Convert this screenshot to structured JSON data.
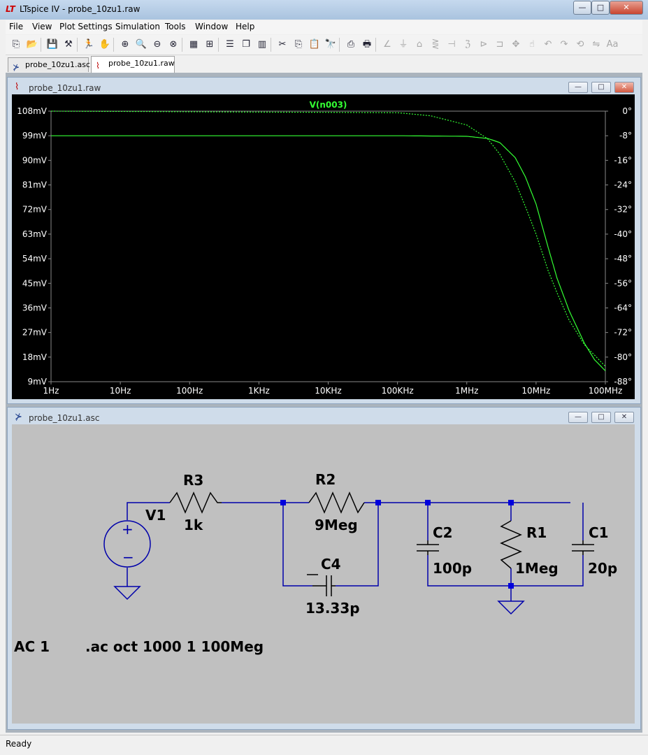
{
  "window": {
    "title": "LTspice IV - probe_10zu1.raw",
    "app_icon": "LT",
    "buttons": {
      "minimize": "—",
      "maximize": "□",
      "close": "✕"
    }
  },
  "menu": [
    "File",
    "View",
    "Plot Settings",
    "Simulation",
    "Tools",
    "Window",
    "Help"
  ],
  "toolbar": {
    "icons": [
      "open-schematic-icon",
      "open-file-icon",
      "save-icon",
      "control-panel-icon",
      "run-icon",
      "halt-icon",
      "zoom-in-icon",
      "zoom-area-icon",
      "zoom-out-icon",
      "zoom-cancel-icon",
      "autorange-icon",
      "mark-icon",
      "tile-horizontal-icon",
      "cascade-icon",
      "tile-vertical-icon",
      "cut-icon",
      "copy-icon",
      "paste-icon",
      "find-icon",
      "print-setup-icon",
      "print-icon",
      "wire-icon",
      "ground-icon",
      "label-icon",
      "resistor-icon",
      "capacitor-icon",
      "inductor-icon",
      "diode-icon",
      "component-icon",
      "move-icon",
      "drag-icon",
      "undo-icon",
      "redo-icon",
      "rotate-icon",
      "mirror-icon",
      "text-icon"
    ]
  },
  "tabs": [
    {
      "label": "probe_10zu1.asc",
      "icon": "schematic-icon",
      "active": false
    },
    {
      "label": "probe_10zu1.raw",
      "icon": "waveform-icon",
      "active": true
    }
  ],
  "plot_window": {
    "title": "probe_10zu1.raw",
    "trace_label": "V(n003)",
    "trace_color": "#33ff33",
    "background": "#000000"
  },
  "chart_data": {
    "type": "line",
    "xscale": "log",
    "xlim": [
      1,
      100000000
    ],
    "x_ticks": [
      "1Hz",
      "10Hz",
      "100Hz",
      "1KHz",
      "10KHz",
      "100KHz",
      "1MHz",
      "10MHz",
      "100MHz"
    ],
    "y_left_ticks": [
      "108mV",
      "99mV",
      "90mV",
      "81mV",
      "72mV",
      "63mV",
      "54mV",
      "45mV",
      "36mV",
      "27mV",
      "18mV",
      "9mV"
    ],
    "y_right_ticks": [
      "0°",
      "-8°",
      "-16°",
      "-24°",
      "-32°",
      "-40°",
      "-48°",
      "-56°",
      "-64°",
      "-72°",
      "-80°",
      "-88°"
    ],
    "ylim_left": [
      9,
      108
    ],
    "ylim_right": [
      -88,
      0
    ],
    "series": [
      {
        "name": "V(n003)",
        "style": "solid",
        "axis": "left",
        "x": [
          1,
          1000,
          100000,
          1000000,
          2000000,
          3000000,
          5000000,
          7000000,
          10000000,
          15000000,
          20000000,
          30000000,
          50000000,
          70000000,
          100000000
        ],
        "y": [
          99,
          99,
          99,
          98.8,
          98,
          96.5,
          91,
          84,
          74,
          58,
          47,
          35,
          23,
          17,
          13
        ]
      },
      {
        "name": "phase",
        "style": "dotted",
        "axis": "right",
        "x": [
          1,
          100000,
          300000,
          1000000,
          2000000,
          3000000,
          5000000,
          7000000,
          10000000,
          15000000,
          20000000,
          30000000,
          50000000,
          100000000
        ],
        "y": [
          0,
          -0.5,
          -1.5,
          -4.5,
          -9,
          -14,
          -23,
          -31,
          -40,
          -52,
          -59,
          -68,
          -76,
          -83
        ]
      }
    ]
  },
  "schematic_window": {
    "title": "probe_10zu1.asc",
    "components": {
      "V1": {
        "name": "V1"
      },
      "R3": {
        "name": "R3",
        "value": "1k"
      },
      "R2": {
        "name": "R2",
        "value": "9Meg"
      },
      "C4": {
        "name": "C4",
        "value": "13.33p"
      },
      "C2": {
        "name": "C2",
        "value": "100p"
      },
      "R1": {
        "name": "R1",
        "value": "1Meg"
      },
      "C1": {
        "name": "C1",
        "value": "20p"
      }
    },
    "source_directive": "AC 1",
    "sim_directive": ".ac oct 1000 1 100Meg"
  },
  "status": "Ready"
}
